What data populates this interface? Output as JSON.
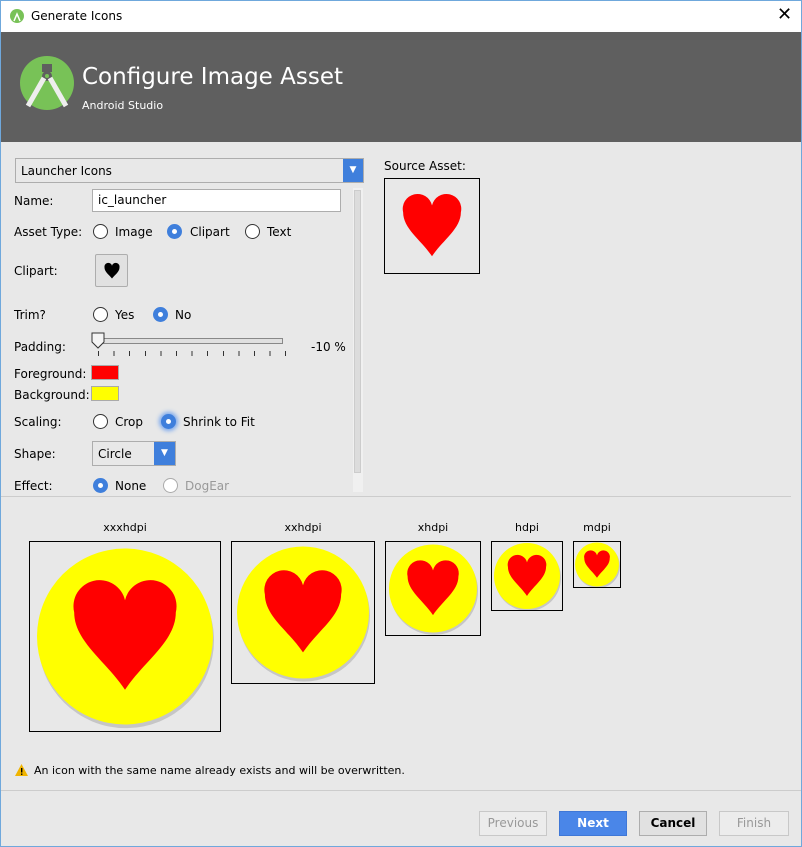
{
  "window": {
    "title": "Generate Icons",
    "close_icon": "close-icon"
  },
  "header": {
    "title": "Configure Image Asset",
    "subtitle": "Android Studio"
  },
  "form": {
    "icon_type": "Launcher Icons",
    "name_label": "Name:",
    "name_value": "ic_launcher",
    "asset_type_label": "Asset Type:",
    "asset_types": [
      "Image",
      "Clipart",
      "Text"
    ],
    "asset_type_selected": "Clipart",
    "clipart_label": "Clipart:",
    "clipart_icon": "heart-icon",
    "trim_label": "Trim?",
    "trim_options": [
      "Yes",
      "No"
    ],
    "trim_selected": "No",
    "padding_label": "Padding:",
    "padding_value": "-10 %",
    "padding_percent": -10,
    "foreground_label": "Foreground:",
    "foreground_color": "#ff0000",
    "background_label": "Background:",
    "background_color": "#ffff00",
    "scaling_label": "Scaling:",
    "scaling_options": [
      "Crop",
      "Shrink to Fit"
    ],
    "scaling_selected": "Shrink to Fit",
    "shape_label": "Shape:",
    "shape_value": "Circle",
    "effect_label": "Effect:",
    "effect_options": [
      "None",
      "DogEar"
    ],
    "effect_selected": "None"
  },
  "source": {
    "label": "Source Asset:"
  },
  "previews": [
    {
      "label": "xxxhdpi"
    },
    {
      "label": "xxhdpi"
    },
    {
      "label": "xhdpi"
    },
    {
      "label": "hdpi"
    },
    {
      "label": "mdpi"
    }
  ],
  "warning": "An icon with the same name already exists and will be overwritten.",
  "buttons": {
    "previous": "Previous",
    "next": "Next",
    "cancel": "Cancel",
    "finish": "Finish"
  }
}
